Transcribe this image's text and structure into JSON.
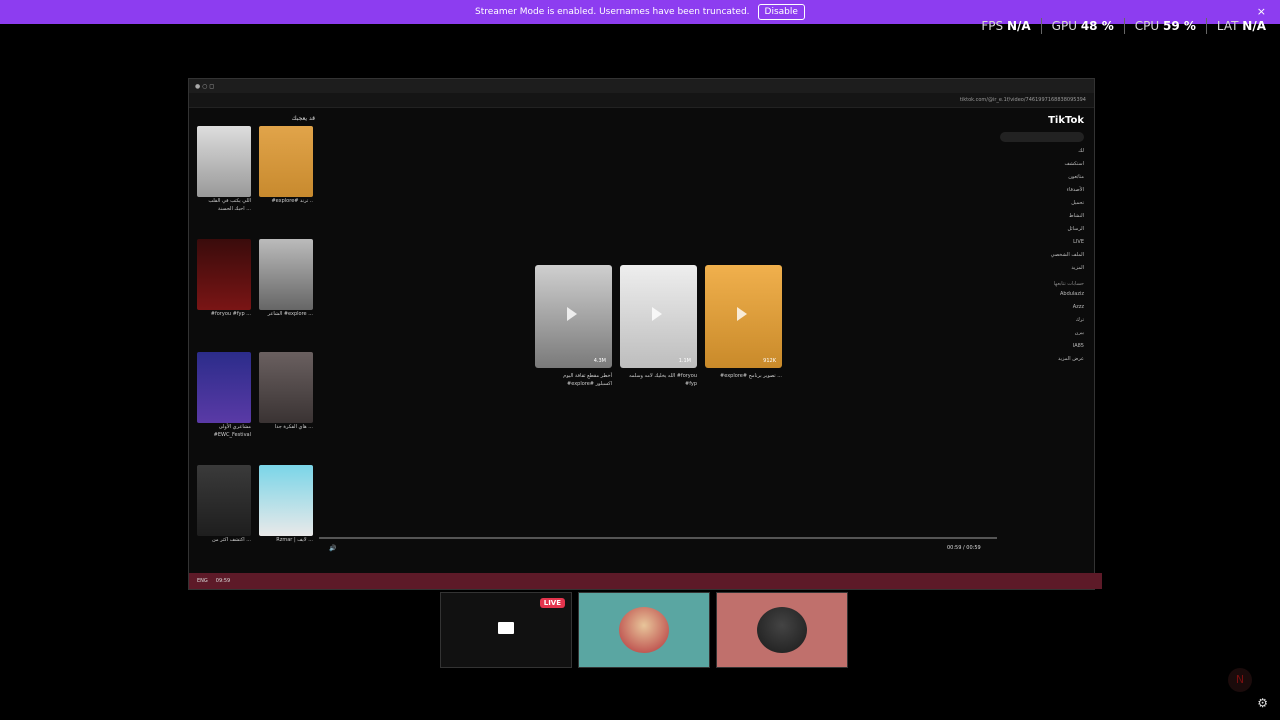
{
  "banner": {
    "message": "Streamer Mode is enabled. Usernames have been truncated.",
    "disable": "Disable",
    "close": "×"
  },
  "stats": {
    "fps_label": "FPS",
    "fps": "N/A",
    "gpu_label": "GPU",
    "gpu": "48 %",
    "cpu_label": "CPU",
    "cpu": "59 %",
    "lat_label": "LAT",
    "lat": "N/A"
  },
  "browser": {
    "url": "tiktok.com/@ir_e.1f/video/7461997168838095394"
  },
  "tiktok": {
    "logo": "TikTok",
    "nav": [
      "لك",
      "استكشف",
      "متابَعون",
      "الأصدقاء",
      "تحميل",
      "النشاط",
      "الرسائل",
      "LIVE",
      "الملف الشخصي",
      "المزيد"
    ],
    "following_title": "حسابات تتابعها",
    "following": [
      "Abdulaziz",
      "Azzz",
      "ترك",
      "بيرن",
      "IA85"
    ],
    "see_more": "عرض المزيد",
    "left_title": "قد يعجبك",
    "left_items": [
      {
        "caption": "اللي يكتب في القلب احبك الحسنة ..."
      },
      {
        "caption": "#explore# ترند .."
      },
      {
        "caption": "#foryou #fyp ..."
      },
      {
        "caption": "الشاعر #explore ..."
      },
      {
        "caption": "مشاعري الأولى #EWC_Festival"
      },
      {
        "caption": "هاي الفكرة جدا ..."
      },
      {
        "caption": "اكتشف اكثر من ..."
      },
      {
        "caption": "Rzmar | لايف ..."
      }
    ],
    "videos": [
      {
        "count": "4.3M",
        "caption": "أخطر مقطع ثقافة اليوم #explore# اكسبلور"
      },
      {
        "count": "1.1M",
        "caption": "الله يخليك لامه وسلمه #foryou #fyp"
      },
      {
        "count": "912K",
        "caption": "#explore# تصوير برنامج ..."
      }
    ],
    "time": "00:59 / 00:59"
  },
  "taskbar": {
    "items": [
      "ENG",
      "09:59"
    ]
  },
  "call": {
    "live": "LIVE"
  },
  "colors": {
    "banner": "#8d3df0",
    "tile2": "#5aa6a2",
    "tile3": "#c0706c"
  }
}
